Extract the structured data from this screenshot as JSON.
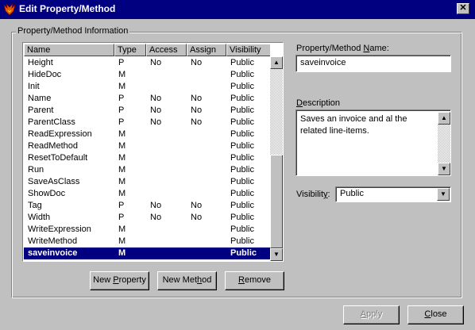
{
  "window": {
    "title": "Edit Property/Method",
    "close_glyph": "✕"
  },
  "group": {
    "label": "Property/Method Information"
  },
  "list": {
    "columns": [
      "Name",
      "Type",
      "Access",
      "Assign",
      "Visibility"
    ],
    "rows": [
      {
        "name": "Height",
        "type": "P",
        "access": "No",
        "assign": "No",
        "visibility": "Public"
      },
      {
        "name": "HideDoc",
        "type": "M",
        "access": "",
        "assign": "",
        "visibility": "Public"
      },
      {
        "name": "Init",
        "type": "M",
        "access": "",
        "assign": "",
        "visibility": "Public"
      },
      {
        "name": "Name",
        "type": "P",
        "access": "No",
        "assign": "No",
        "visibility": "Public"
      },
      {
        "name": "Parent",
        "type": "P",
        "access": "No",
        "assign": "No",
        "visibility": "Public"
      },
      {
        "name": "ParentClass",
        "type": "P",
        "access": "No",
        "assign": "No",
        "visibility": "Public"
      },
      {
        "name": "ReadExpression",
        "type": "M",
        "access": "",
        "assign": "",
        "visibility": "Public"
      },
      {
        "name": "ReadMethod",
        "type": "M",
        "access": "",
        "assign": "",
        "visibility": "Public"
      },
      {
        "name": "ResetToDefault",
        "type": "M",
        "access": "",
        "assign": "",
        "visibility": "Public"
      },
      {
        "name": "Run",
        "type": "M",
        "access": "",
        "assign": "",
        "visibility": "Public"
      },
      {
        "name": "SaveAsClass",
        "type": "M",
        "access": "",
        "assign": "",
        "visibility": "Public"
      },
      {
        "name": "ShowDoc",
        "type": "M",
        "access": "",
        "assign": "",
        "visibility": "Public"
      },
      {
        "name": "Tag",
        "type": "P",
        "access": "No",
        "assign": "No",
        "visibility": "Public"
      },
      {
        "name": "Width",
        "type": "P",
        "access": "No",
        "assign": "No",
        "visibility": "Public"
      },
      {
        "name": "WriteExpression",
        "type": "M",
        "access": "",
        "assign": "",
        "visibility": "Public"
      },
      {
        "name": "WriteMethod",
        "type": "M",
        "access": "",
        "assign": "",
        "visibility": "Public"
      },
      {
        "name": "saveinvoice",
        "type": "M",
        "access": "",
        "assign": "",
        "visibility": "Public",
        "selected": true
      }
    ]
  },
  "buttons": {
    "new_property_pre": "New ",
    "new_property_key": "P",
    "new_property_post": "roperty",
    "new_method_pre": "New Met",
    "new_method_key": "h",
    "new_method_post": "od",
    "remove_key": "R",
    "remove_post": "emove",
    "apply_key": "A",
    "apply_post": "pply",
    "close_key": "C",
    "close_post": "lose"
  },
  "name_field": {
    "label_pre": "Property/Method ",
    "label_key": "N",
    "label_post": "ame:",
    "value": "saveinvoice"
  },
  "description": {
    "label_key": "D",
    "label_post": "escription",
    "value": "Saves an invoice and al the related line-items."
  },
  "visibility": {
    "label_pre": "Visibilit",
    "label_key": "y",
    "label_post": ":",
    "value": "Public"
  },
  "icons": {
    "app": "fox-app-icon",
    "scroll_up": "▲",
    "scroll_down": "▼",
    "dropdown": "▼"
  }
}
